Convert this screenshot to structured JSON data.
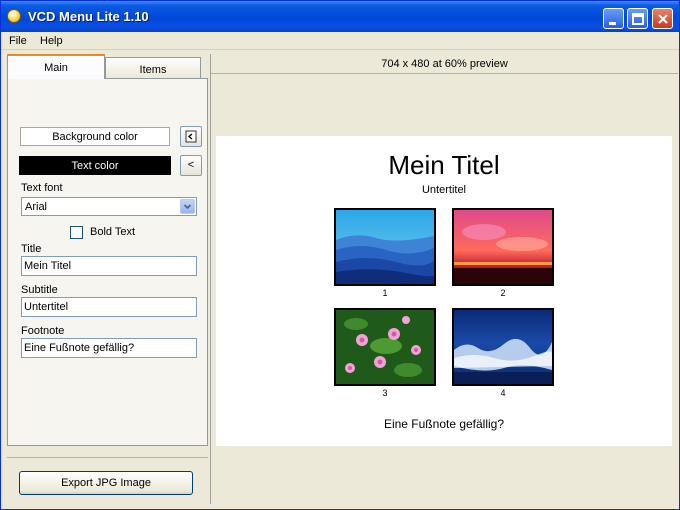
{
  "window": {
    "title": "VCD Menu Lite 1.10",
    "app_icon": "disc-icon",
    "controls": [
      "minimize-icon",
      "maximize-icon",
      "close-icon"
    ]
  },
  "menubar": {
    "items": [
      "File",
      "Help"
    ]
  },
  "tabs": [
    {
      "label": "Main",
      "active": true
    },
    {
      "label": "Items",
      "active": false
    }
  ],
  "main_panel": {
    "background_color_label": "Background color",
    "text_color_label": "Text color",
    "background_color": "#ffffff",
    "text_color": "#000000",
    "picker_button": "<",
    "text_font_label": "Text font",
    "text_font_value": "Arial",
    "bold_label": "Bold Text",
    "bold_checked": false,
    "title_label": "Title",
    "title_value": "Mein Titel",
    "subtitle_label": "Subtitle",
    "subtitle_value": "Untertitel",
    "footnote_label": "Footnote",
    "footnote_value": "Eine Fußnote gefällig?",
    "export_button": "Export JPG Image"
  },
  "preview": {
    "status": "704 x 480 at 60% preview",
    "title": "Mein Titel",
    "subtitle": "Untertitel",
    "footnote": "Eine Fußnote gefällig?",
    "items": [
      {
        "label": "1",
        "image": "blue-mountains"
      },
      {
        "label": "2",
        "image": "red-sunset"
      },
      {
        "label": "3",
        "image": "pink-flowers"
      },
      {
        "label": "4",
        "image": "blue-water"
      }
    ]
  }
}
